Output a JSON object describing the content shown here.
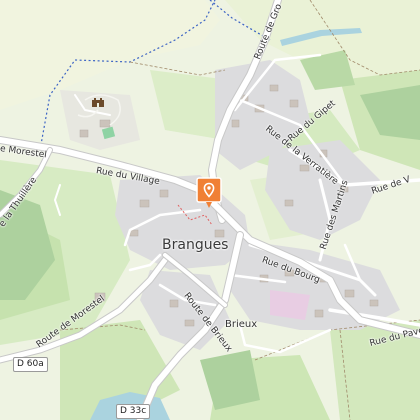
{
  "map": {
    "place_name": "Brangues",
    "hamlet_name": "Brieux",
    "roads": {
      "route_de_groslee": "Route de Gro",
      "rue_du_village": "Rue du Village",
      "rue_du_bourg": "Rue du Bourg",
      "route_de_morestel": "Route de Morestel",
      "route_de_la_thuiliere": "e la Thuillère",
      "route_de_brieux": "Route de Brieux",
      "rue_du_gipet": "Rue du Gipet",
      "rue_de_la_verrattiere": "Rue de la Verratière",
      "rue_des_martins": "Rue des Martins",
      "rue_du_pave": "Rue du Pavé",
      "rue_de_v": "Rue de V",
      "route_left": "e Morestel"
    },
    "shields": {
      "d60a": "D 60a",
      "d33c": "D 33c"
    },
    "icons": {
      "castle": "castle-icon",
      "marker": "location-pin-icon"
    },
    "colors": {
      "marker": "#f08035",
      "road": "#ffffff",
      "residential": "#dcdcde",
      "water": "#aad3df",
      "boundary": "#3b63c4"
    }
  }
}
